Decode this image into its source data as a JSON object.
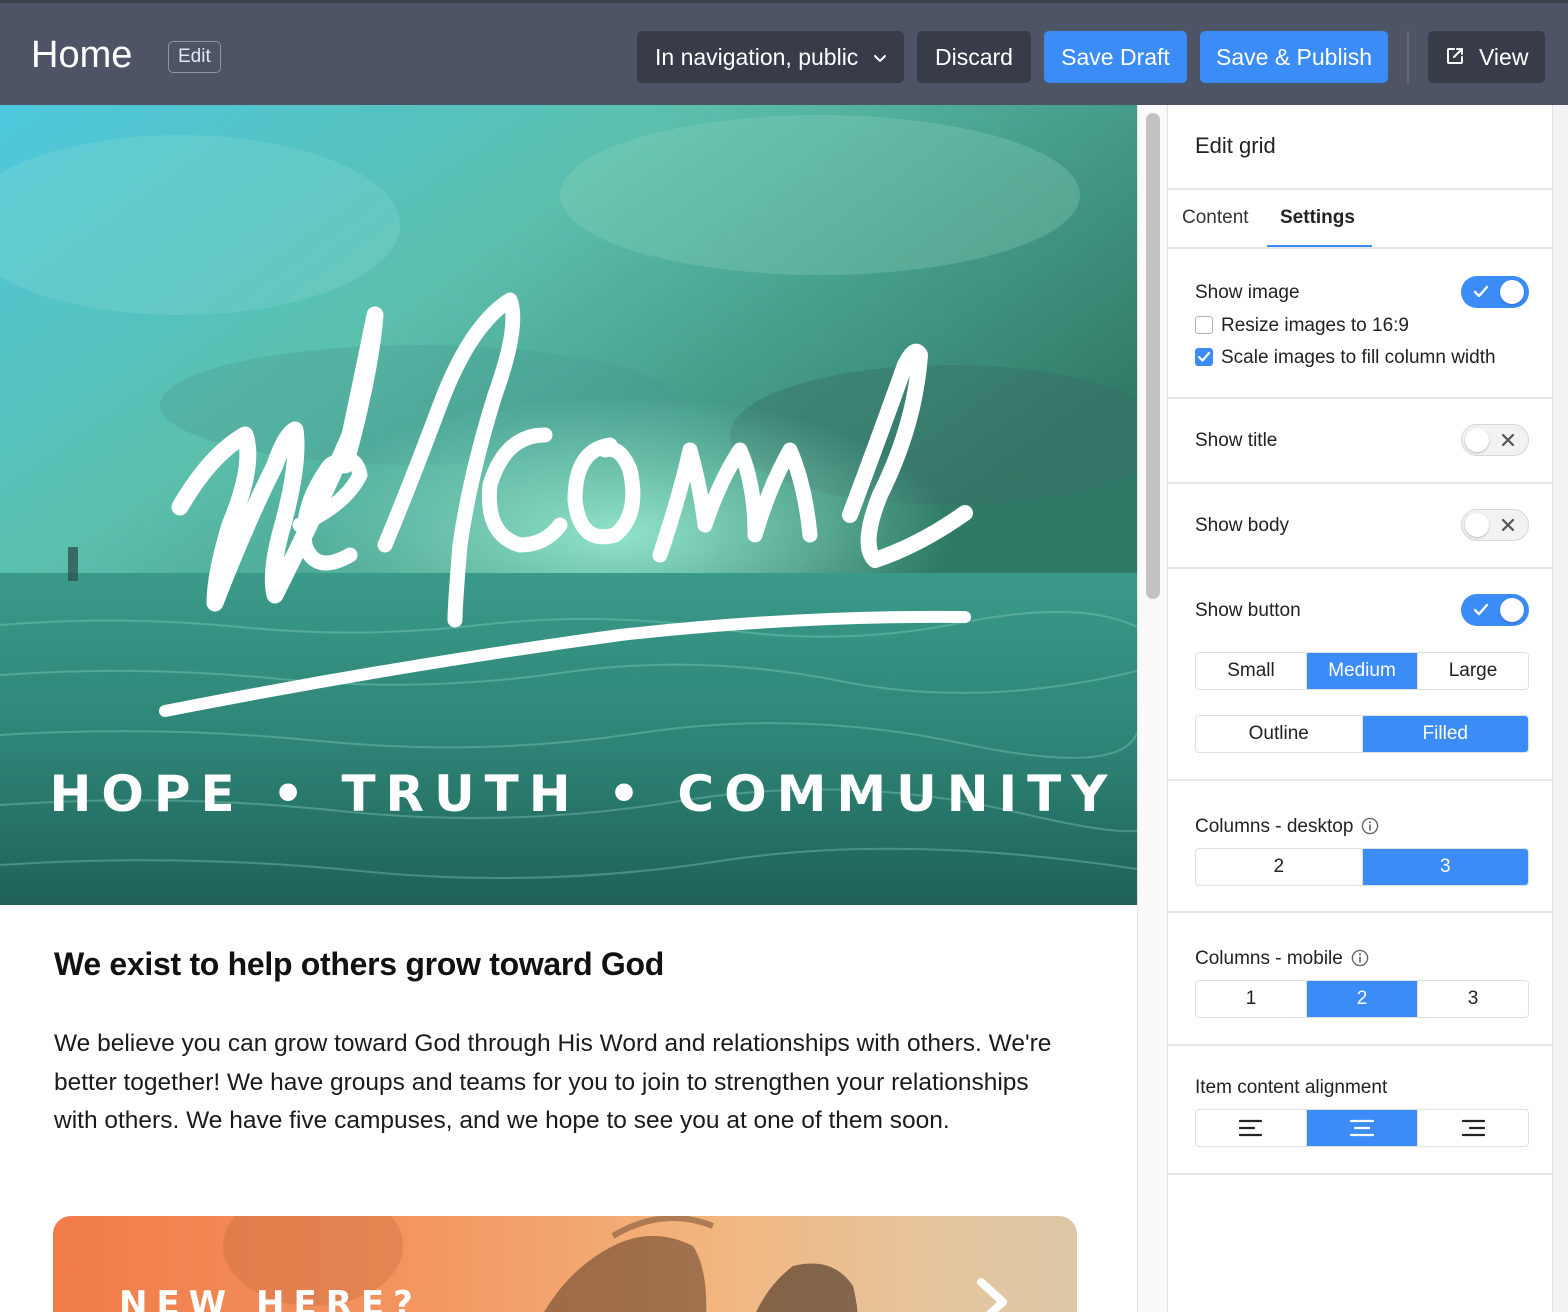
{
  "topbar": {
    "page_title": "Home",
    "edit_badge": "Edit",
    "nav_select": "In navigation, public",
    "discard": "Discard",
    "save_draft": "Save Draft",
    "save_publish": "Save & Publish",
    "view": "View"
  },
  "hero": {
    "script_text": "Welcome",
    "tagline": "HOPE • TRUTH • COMMUNITY"
  },
  "content": {
    "heading": "We exist to help others grow toward God",
    "body": "We believe you can grow toward God through His Word and relationships with others. We're better together! We have groups and teams for you to join to strengthen your relationships with others. We have five campuses, and we hope to see you at one of them soon."
  },
  "card": {
    "title": "NEW HERE?"
  },
  "panel": {
    "title": "Edit grid",
    "tabs": [
      {
        "label": "Content",
        "active": false
      },
      {
        "label": "Settings",
        "active": true
      }
    ],
    "show_image": {
      "label": "Show image",
      "on": true,
      "resize_label": "Resize images to 16:9",
      "resize_checked": false,
      "scale_label": "Scale images to fill column width",
      "scale_checked": true
    },
    "show_title": {
      "label": "Show title",
      "on": false
    },
    "show_body": {
      "label": "Show body",
      "on": false
    },
    "show_button": {
      "label": "Show button",
      "on": true,
      "sizes": [
        "Small",
        "Medium",
        "Large"
      ],
      "size_selected": "Medium",
      "styles": [
        "Outline",
        "Filled"
      ],
      "style_selected": "Filled"
    },
    "columns_desktop": {
      "label": "Columns - desktop",
      "options": [
        "2",
        "3"
      ],
      "selected": "3"
    },
    "columns_mobile": {
      "label": "Columns - mobile",
      "options": [
        "1",
        "2",
        "3"
      ],
      "selected": "2"
    },
    "alignment": {
      "label": "Item content alignment",
      "options": [
        "align-left-icon",
        "align-center-icon",
        "align-right-icon"
      ],
      "selected": "align-center-icon"
    }
  },
  "colors": {
    "accent": "#3c8cf8",
    "topbar": "#4d5466",
    "topbar_button": "#373c48"
  }
}
